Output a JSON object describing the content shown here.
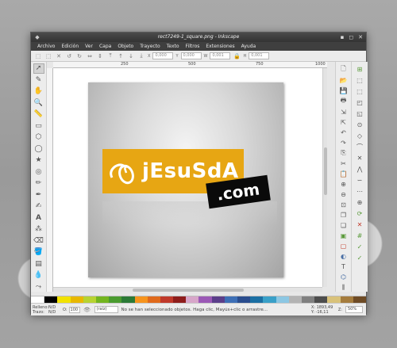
{
  "window": {
    "title": "rect7249-1_square.png - Inkscape"
  },
  "menu": [
    "Archivo",
    "Edición",
    "Ver",
    "Capa",
    "Objeto",
    "Trayecto",
    "Texto",
    "Filtros",
    "Extensiones",
    "Ayuda"
  ],
  "cmdbar": {
    "x_label": "X",
    "x_value": "0,000",
    "y_label": "Y",
    "y_value": "0,000",
    "w_label": "W",
    "w_value": "0,001",
    "h_label": "H",
    "h_value": "0,001"
  },
  "ruler": {
    "t1": "250",
    "t2": "500",
    "t3": "750",
    "t4": "1000"
  },
  "logo": {
    "text": "jEsuSdA",
    "com": ".com"
  },
  "status": {
    "fill_label": "Relleno:",
    "stroke_label": "Trazo:",
    "fill_value": "N/D",
    "stroke_value": "N/D",
    "opacity_label": "O:",
    "opacity_value": "100",
    "layer": "(raíz)",
    "message": "No se han seleccionado objetos. Haga clic, Mayús+clic o arrastre...",
    "x_coord": "X: 1893,49",
    "y_coord": "Y: -16,11",
    "zoom_label": "Z:",
    "zoom": "50%"
  },
  "palette": [
    "#ffffff",
    "#000000",
    "#f2e200",
    "#e8b800",
    "#b7d331",
    "#73b51f",
    "#4a9b2f",
    "#2b7a36",
    "#f7941d",
    "#e06a1c",
    "#c0392b",
    "#8e1d1b",
    "#d7a6c9",
    "#9b59b6",
    "#5b3e8a",
    "#3d6fb6",
    "#2a4d8e",
    "#1b6fa3",
    "#39a0c8",
    "#8cc7e3",
    "#b3b3b3",
    "#808080",
    "#4d4d4d",
    "#d9c27a",
    "#a57c3d",
    "#6e4b25"
  ]
}
